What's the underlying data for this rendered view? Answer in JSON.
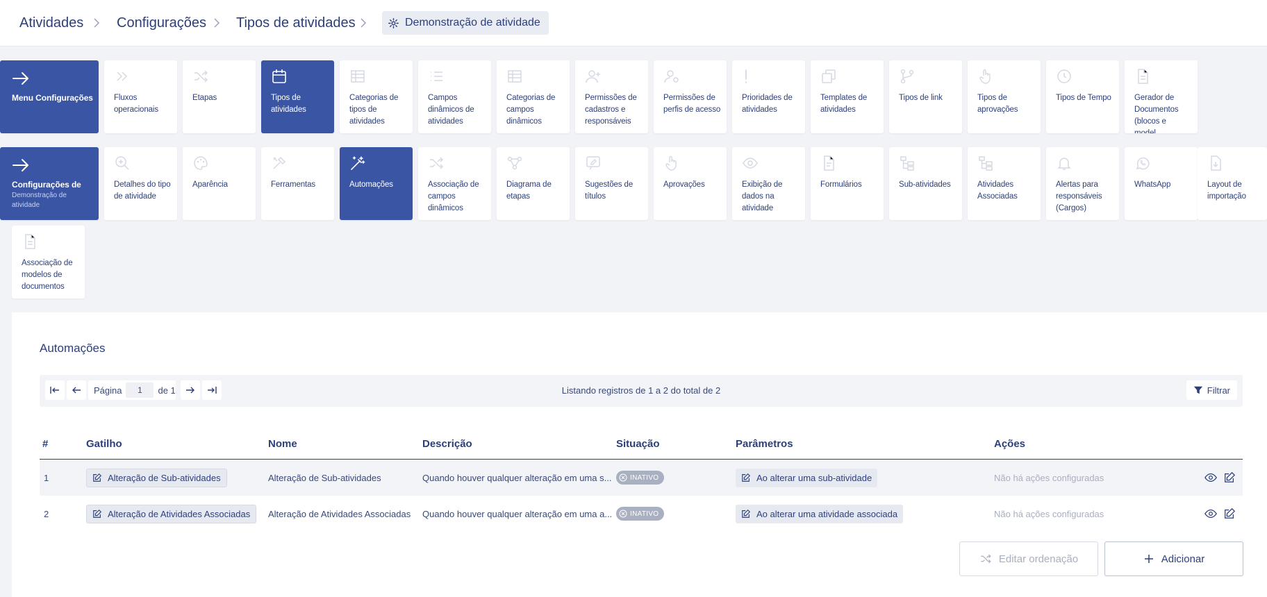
{
  "breadcrumb": {
    "items": [
      "Atividades",
      "Configurações",
      "Tipos de atividades"
    ],
    "current": "Demonstração de atividade"
  },
  "menu_tiles": {
    "row1_header": {
      "title": "Menu Configurações",
      "icon": "arrow-right-icon"
    },
    "row1": [
      {
        "label": "Fluxos operacionais",
        "icon": "double-chevron-icon"
      },
      {
        "label": "Etapas",
        "icon": "shuffle-icon"
      },
      {
        "label": "Tipos de atividades",
        "icon": "calendar-icon",
        "active": true
      },
      {
        "label": "Categorias de tipos de atividades",
        "icon": "table-icon"
      },
      {
        "label": "Campos dinâmicos de atividades",
        "icon": "list-icon"
      },
      {
        "label": "Categorias de campos dinâmicos",
        "icon": "table-icon"
      },
      {
        "label": "Permissões de cadastros e responsáveis",
        "icon": "user-plus-icon"
      },
      {
        "label": "Permissões de perfis de acesso",
        "icon": "user-gear-icon"
      },
      {
        "label": "Prioridades de atividades",
        "icon": "exclamation-icon"
      },
      {
        "label": "Templates de atividades",
        "icon": "copy-icon"
      },
      {
        "label": "Tipos de link",
        "icon": "git-branch-icon"
      },
      {
        "label": "Tipos de aprovações",
        "icon": "hand-pointer-icon"
      },
      {
        "label": "Tipos de Tempo",
        "icon": "clock-icon"
      },
      {
        "label": "Gerador de Documentos (blocos e model...",
        "icon": "document-icon"
      }
    ],
    "row2_header": {
      "title": "Configurações de",
      "subtitle": "Demonstração de atividade",
      "icon": "arrow-right-icon"
    },
    "row2": [
      {
        "label": "Detalhes do tipo de atividade",
        "icon": "zoom-in-icon"
      },
      {
        "label": "Aparência",
        "icon": "palette-icon"
      },
      {
        "label": "Ferramentas",
        "icon": "tools-icon"
      },
      {
        "label": "Automações",
        "icon": "magic-wand-icon",
        "active": true
      },
      {
        "label": "Associação de campos dinâmicos",
        "icon": "shuffle-icon"
      },
      {
        "label": "Diagrama de etapas",
        "icon": "diagram-icon"
      },
      {
        "label": "Sugestões de títulos",
        "icon": "comment-edit-icon"
      },
      {
        "label": "Aprovações",
        "icon": "hand-pointer-icon"
      },
      {
        "label": "Exibição de dados na atividade",
        "icon": "eye-icon"
      },
      {
        "label": "Formulários",
        "icon": "form-icon"
      },
      {
        "label": "Sub-atividades",
        "icon": "hierarchy-icon"
      },
      {
        "label": "Atividades Associadas",
        "icon": "hierarchy-icon"
      },
      {
        "label": "Alertas para responsáveis (Cargos)",
        "icon": "bell-icon"
      },
      {
        "label": "WhatsApp",
        "icon": "whatsapp-icon"
      },
      {
        "label": "Layout de importação",
        "icon": "file-import-icon"
      }
    ],
    "row3": [
      {
        "label": "Associação de modelos de documentos",
        "icon": "document-icon"
      }
    ]
  },
  "panel": {
    "title": "Automações",
    "pagination": {
      "page_label": "Página",
      "page_value": "1",
      "of_label": "de 1",
      "listing": "Listando registros de 1 a 2 do total de 2",
      "filter_label": "Filtrar"
    },
    "table": {
      "headers": [
        "#",
        "Gatilho",
        "Nome",
        "Descrição",
        "Situação",
        "Parâmetros",
        "Ações"
      ],
      "rows": [
        {
          "num": "1",
          "trigger": "Alteração de Sub-atividades",
          "name": "Alteração de Sub-atividades",
          "description": "Quando houver qualquer alteração em uma s...",
          "status": "INATIVO",
          "parameter": "Ao alterar uma sub-atividade",
          "actions": "Não há ações configuradas"
        },
        {
          "num": "2",
          "trigger": "Alteração de Atividades Associadas",
          "name": "Alteração de Atividades Associadas",
          "description": "Quando houver qualquer alteração em uma a...",
          "status": "INATIVO",
          "parameter": "Ao alterar uma atividade associada",
          "actions": "Não há ações configuradas"
        }
      ]
    },
    "buttons": {
      "edit_order": "Editar ordenação",
      "add": "Adicionar"
    }
  },
  "colors": {
    "primary": "#3a55a4",
    "text": "#2d3f7a",
    "muted": "#a9afbe",
    "background": "#f2f3f7",
    "badge_inactive": "#a9b0c1"
  }
}
